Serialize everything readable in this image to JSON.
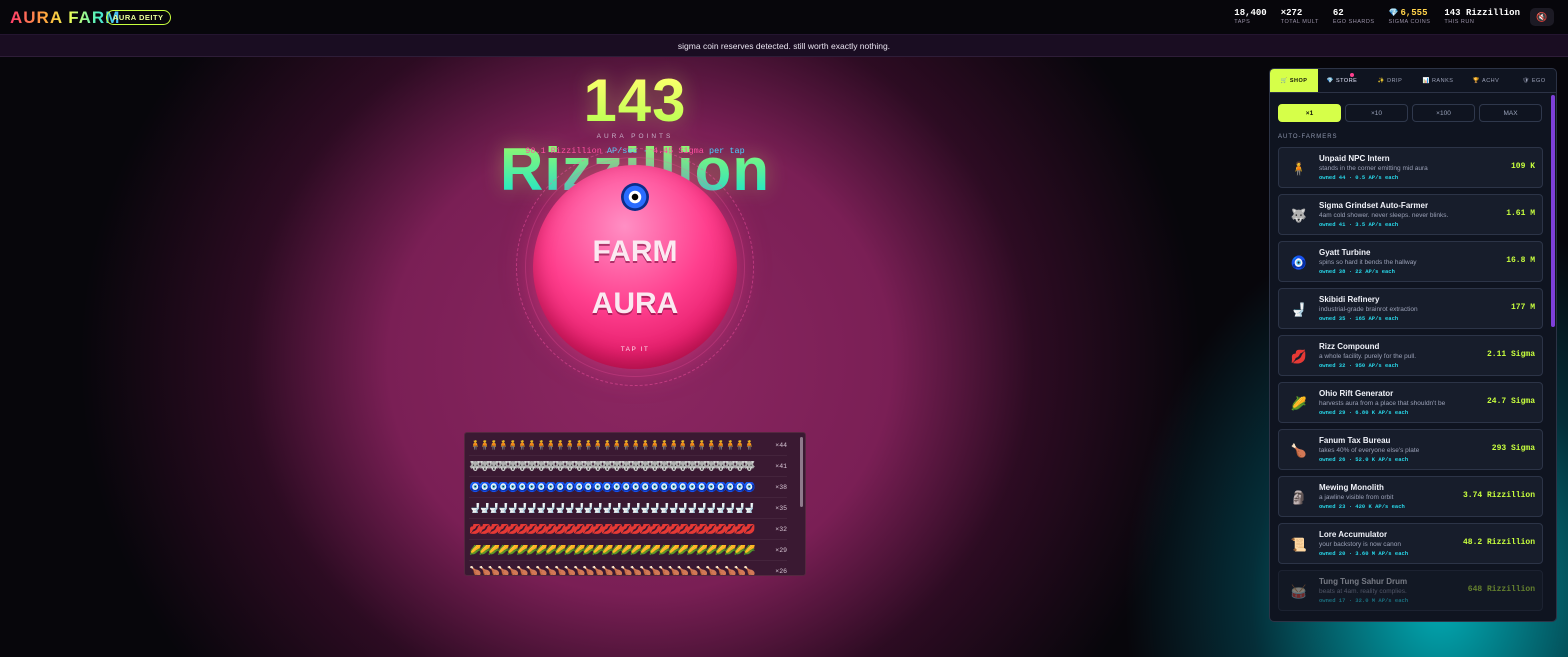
{
  "header": {
    "logo": "AURA FARM",
    "badge": "AURA DEITY",
    "stats": [
      {
        "value": "18,400",
        "label": "TAPS"
      },
      {
        "value": "×272",
        "label": "TOTAL MULT"
      },
      {
        "value": "62",
        "label": "EGO SHARDS"
      },
      {
        "value": "6,555",
        "label": "SIGMA COINS"
      },
      {
        "value": "143 Rizzillion",
        "label": "THIS RUN"
      }
    ],
    "sound_icon": "speaker-icon"
  },
  "ticker": "sigma coin reserves detected. still worth exactly nothing.",
  "score": {
    "value": "143 Rizzillion",
    "label": "AURA POINTS",
    "rate_value": "90.1 Rizzillion",
    "rate_unit": "AP/sec",
    "separator": "·",
    "tap_value": "4.45 Sigma",
    "tap_unit": "per tap"
  },
  "orb": {
    "line1": "FARM",
    "line2": "AURA",
    "hint": "TAP IT"
  },
  "collection": [
    {
      "icon": "🧍",
      "count": "×44"
    },
    {
      "icon": "🐺",
      "count": "×41"
    },
    {
      "icon": "🧿",
      "count": "×38"
    },
    {
      "icon": "🚽",
      "count": "×35"
    },
    {
      "icon": "💋",
      "count": "×32"
    },
    {
      "icon": "🌽",
      "count": "×29"
    },
    {
      "icon": "🍗",
      "count": "×26"
    }
  ],
  "panel": {
    "tabs": [
      {
        "icon": "🛒",
        "label": "SHOP"
      },
      {
        "icon": "💎",
        "label": "STORE"
      },
      {
        "icon": "✨",
        "label": "DRIP"
      },
      {
        "icon": "📊",
        "label": "RANKS"
      },
      {
        "icon": "🏆",
        "label": "ACHV"
      },
      {
        "icon": "🛡",
        "label": "EGO"
      }
    ],
    "multipliers": [
      "×1",
      "×10",
      "×100",
      "MAX"
    ],
    "section": "AUTO-FARMERS",
    "items": [
      {
        "icon": "🧍",
        "name": "Unpaid NPC Intern",
        "desc": "stands in the corner emitting mid aura",
        "owned": "owned 44 · 0.5 AP/s each",
        "price": "109 K"
      },
      {
        "icon": "🐺",
        "name": "Sigma Grindset Auto-Farmer",
        "desc": "4am cold shower. never sleeps. never blinks.",
        "owned": "owned 41 · 3.5 AP/s each",
        "price": "1.61 M"
      },
      {
        "icon": "🧿",
        "name": "Gyatt Turbine",
        "desc": "spins so hard it bends the hallway",
        "owned": "owned 38 · 22 AP/s each",
        "price": "16.8 M"
      },
      {
        "icon": "🚽",
        "name": "Skibidi Refinery",
        "desc": "industrial-grade brainrot extraction",
        "owned": "owned 35 · 165 AP/s each",
        "price": "177 M"
      },
      {
        "icon": "💋",
        "name": "Rizz Compound",
        "desc": "a whole facility. purely for the pull.",
        "owned": "owned 32 · 950 AP/s each",
        "price": "2.11 Sigma"
      },
      {
        "icon": "🌽",
        "name": "Ohio Rift Generator",
        "desc": "harvests aura from a place that shouldn't be",
        "owned": "owned 29 · 6.80 K AP/s each",
        "price": "24.7 Sigma"
      },
      {
        "icon": "🍗",
        "name": "Fanum Tax Bureau",
        "desc": "takes 40% of everyone else's plate",
        "owned": "owned 26 · 52.0 K AP/s each",
        "price": "293 Sigma"
      },
      {
        "icon": "🗿",
        "name": "Mewing Monolith",
        "desc": "a jawline visible from orbit",
        "owned": "owned 23 · 420 K AP/s each",
        "price": "3.74 Rizzillion"
      },
      {
        "icon": "📜",
        "name": "Lore Accumulator",
        "desc": "your backstory is now canon",
        "owned": "owned 20 · 3.60 M AP/s each",
        "price": "48.2 Rizzillion"
      },
      {
        "icon": "🥁",
        "name": "Tung Tung Sahur Drum",
        "desc": "beats at 4am. reality complies.",
        "owned": "owned 17 · 32.0 M AP/s each",
        "price": "648 Rizzillion"
      }
    ]
  },
  "colors": {
    "accent": "#d6ff49",
    "pink": "#ff3f8e",
    "cyan": "#28d6e8",
    "gold": "#ffd24a"
  }
}
